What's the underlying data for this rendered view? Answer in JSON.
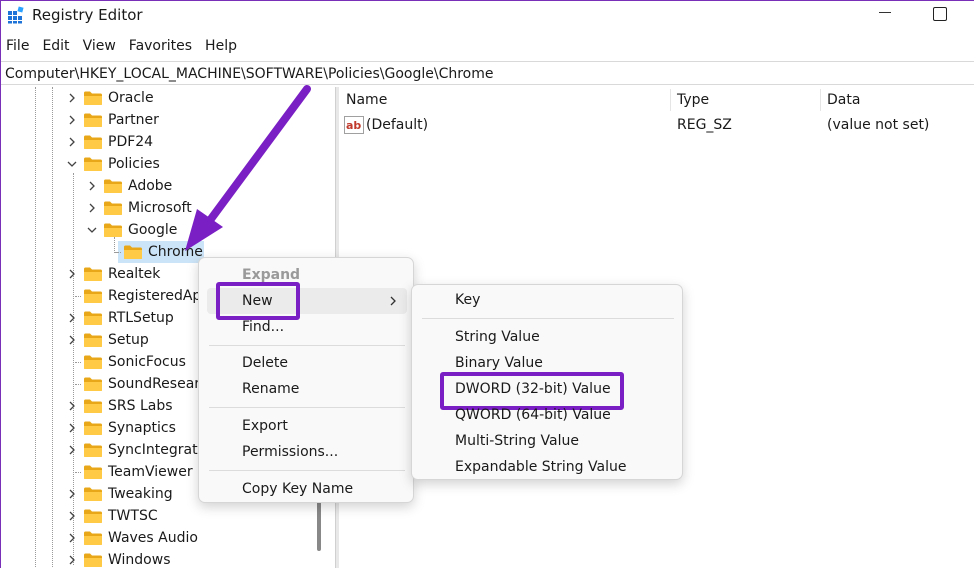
{
  "window": {
    "title": "Registry Editor",
    "app_icon": "registry-editor-icon",
    "accent_color": "#7a1fc4"
  },
  "menubar": {
    "items": [
      "File",
      "Edit",
      "View",
      "Favorites",
      "Help"
    ]
  },
  "addressbar": {
    "path": "Computer\\HKEY_LOCAL_MACHINE\\SOFTWARE\\Policies\\Google\\Chrome"
  },
  "tree": {
    "items": [
      {
        "label": "Oracle"
      },
      {
        "label": "Partner"
      },
      {
        "label": "PDF24"
      },
      {
        "label": "Policies"
      },
      {
        "label": "Adobe"
      },
      {
        "label": "Microsoft"
      },
      {
        "label": "Google"
      },
      {
        "label": "Chrome"
      },
      {
        "label": "Realtek"
      },
      {
        "label": "RegisteredAp"
      },
      {
        "label": "RTLSetup"
      },
      {
        "label": "Setup"
      },
      {
        "label": "SonicFocus"
      },
      {
        "label": "SoundResearc"
      },
      {
        "label": "SRS Labs"
      },
      {
        "label": "Synaptics"
      },
      {
        "label": "SyncIntegratio"
      },
      {
        "label": "TeamViewer"
      },
      {
        "label": "Tweaking"
      },
      {
        "label": "TWTSC"
      },
      {
        "label": "Waves Audio"
      },
      {
        "label": "Windows"
      }
    ]
  },
  "list": {
    "columns": [
      "Name",
      "Type",
      "Data"
    ],
    "rows": [
      {
        "name": "(Default)",
        "type": "REG_SZ",
        "data": "(value not set)"
      }
    ]
  },
  "context_menu": {
    "expand": "Expand",
    "new": "New",
    "find": "Find...",
    "delete": "Delete",
    "rename": "Rename",
    "export": "Export",
    "permissions": "Permissions...",
    "copy_key_name": "Copy Key Name"
  },
  "submenu": {
    "key": "Key",
    "string_value": "String Value",
    "binary_value": "Binary Value",
    "dword_value": "DWORD (32-bit) Value",
    "qword_value": "QWORD (64-bit) Value",
    "multi_string_value": "Multi-String Value",
    "expandable_string_value": "Expandable String Value"
  }
}
